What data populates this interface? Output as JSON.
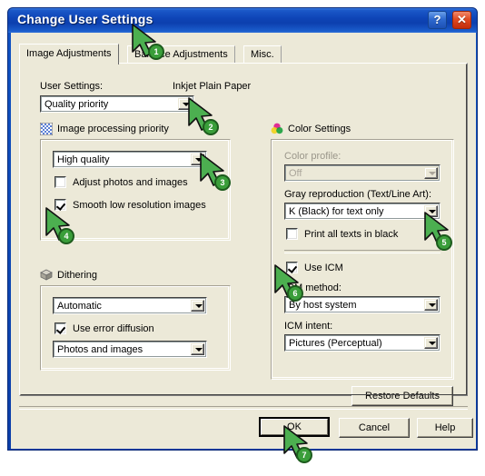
{
  "window": {
    "title": "Change User Settings",
    "help_button": "?",
    "close_button": "✕"
  },
  "tabs": [
    {
      "label": "Image Adjustments",
      "active": true
    },
    {
      "label": "Balance Adjustments",
      "active": false
    },
    {
      "label": "Misc.",
      "active": false
    }
  ],
  "left_panel": {
    "user_settings_label": "User Settings:",
    "paper_type": "Inkjet Plain Paper",
    "user_settings_value": "Quality priority",
    "image_processing": {
      "group_label": "Image processing priority",
      "icon": "dither-pattern-icon",
      "quality_value": "High quality",
      "adjust_photos_label": "Adjust photos and images",
      "adjust_photos_checked": false,
      "smooth_label": "Smooth low resolution images",
      "smooth_checked": true
    },
    "dithering": {
      "group_label": "Dithering",
      "icon": "cube-stack-icon",
      "mode_value": "Automatic",
      "error_diffusion_label": "Use error diffusion",
      "error_diffusion_checked": true,
      "target_value": "Photos and images"
    }
  },
  "right_panel": {
    "color_settings": {
      "group_label": "Color Settings",
      "icon": "color-wheel-icon",
      "color_profile_label": "Color profile:",
      "color_profile_value": "Off",
      "color_profile_disabled": true,
      "gray_reproduction_label": "Gray reproduction (Text/Line Art):",
      "gray_reproduction_value": "K (Black) for text only",
      "print_all_texts_label": "Print all texts in black",
      "print_all_texts_checked": false,
      "use_icm_label": "Use ICM",
      "use_icm_checked": true,
      "icm_method_label": "ICM method:",
      "icm_method_value": "By host system",
      "icm_intent_label": "ICM intent:",
      "icm_intent_value": "Pictures (Perceptual)"
    },
    "restore_defaults_label": "Restore Defaults"
  },
  "footer": {
    "ok_label": "OK",
    "cancel_label": "Cancel",
    "help_label": "Help"
  },
  "annotations": {
    "markers": [
      {
        "number": "1",
        "target": "balance-adjustments-tab"
      },
      {
        "number": "2",
        "target": "user-settings-combo-arrow"
      },
      {
        "number": "3",
        "target": "image-quality-combo-arrow"
      },
      {
        "number": "4",
        "target": "smooth-low-resolution-checkbox"
      },
      {
        "number": "5",
        "target": "gray-reproduction-combo-arrow"
      },
      {
        "number": "6",
        "target": "use-icm-checkbox"
      },
      {
        "number": "7",
        "target": "ok-button"
      }
    ],
    "cursor_color": "#4caf50",
    "badge_color": "#3a9e3a"
  }
}
